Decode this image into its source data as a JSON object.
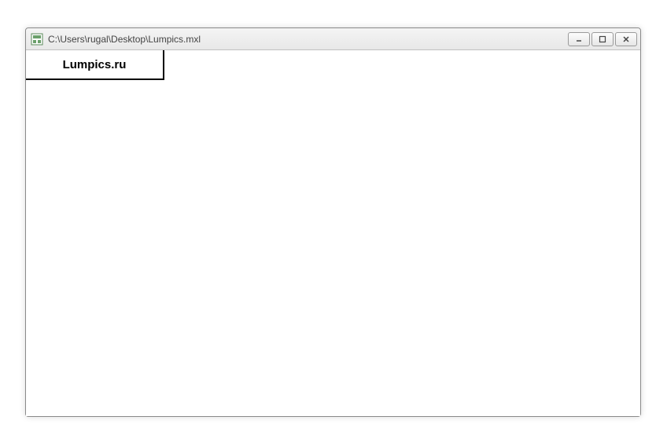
{
  "window": {
    "title": "C:\\Users\\rugal\\Desktop\\Lumpics.mxl"
  },
  "content": {
    "cell_text": "Lumpics.ru"
  }
}
